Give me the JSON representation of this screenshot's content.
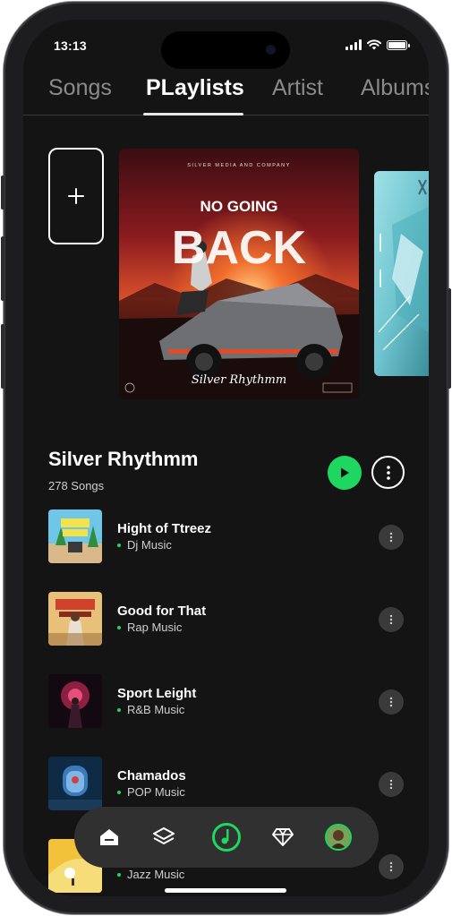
{
  "status_bar": {
    "time": "13:13"
  },
  "tabs": [
    {
      "label": "Songs",
      "active": false
    },
    {
      "label": "PLaylists",
      "active": true
    },
    {
      "label": "Artist",
      "active": false
    },
    {
      "label": "Albums",
      "active": false
    }
  ],
  "covers": {
    "main": {
      "publisher": "SILVER MEDIA AND COMPANY",
      "line1": "NO GOING",
      "line2": "BACK",
      "signature": "Silver Rhythmm"
    }
  },
  "playlist": {
    "title": "Silver Rhythmm",
    "count": "278 Songs"
  },
  "songs": [
    {
      "title": "Hight of Ttreez",
      "genre": "Dj Music"
    },
    {
      "title": "Good for That",
      "genre": "Rap Music"
    },
    {
      "title": "Sport Leight",
      "genre": "R&B Music"
    },
    {
      "title": "Chamados",
      "genre": "POP Music"
    },
    {
      "title": "",
      "genre": "Jazz Music"
    }
  ],
  "bottom_nav": {
    "items": [
      {
        "icon": "home-icon",
        "active": true
      },
      {
        "icon": "layers-icon",
        "active": false
      },
      {
        "icon": "music-disc-icon",
        "active": false
      },
      {
        "icon": "diamond-icon",
        "active": false
      },
      {
        "icon": "profile-avatar",
        "active": false
      }
    ]
  },
  "colors": {
    "accent": "#1ed760",
    "background": "#141414",
    "nav_bg": "#303030"
  }
}
